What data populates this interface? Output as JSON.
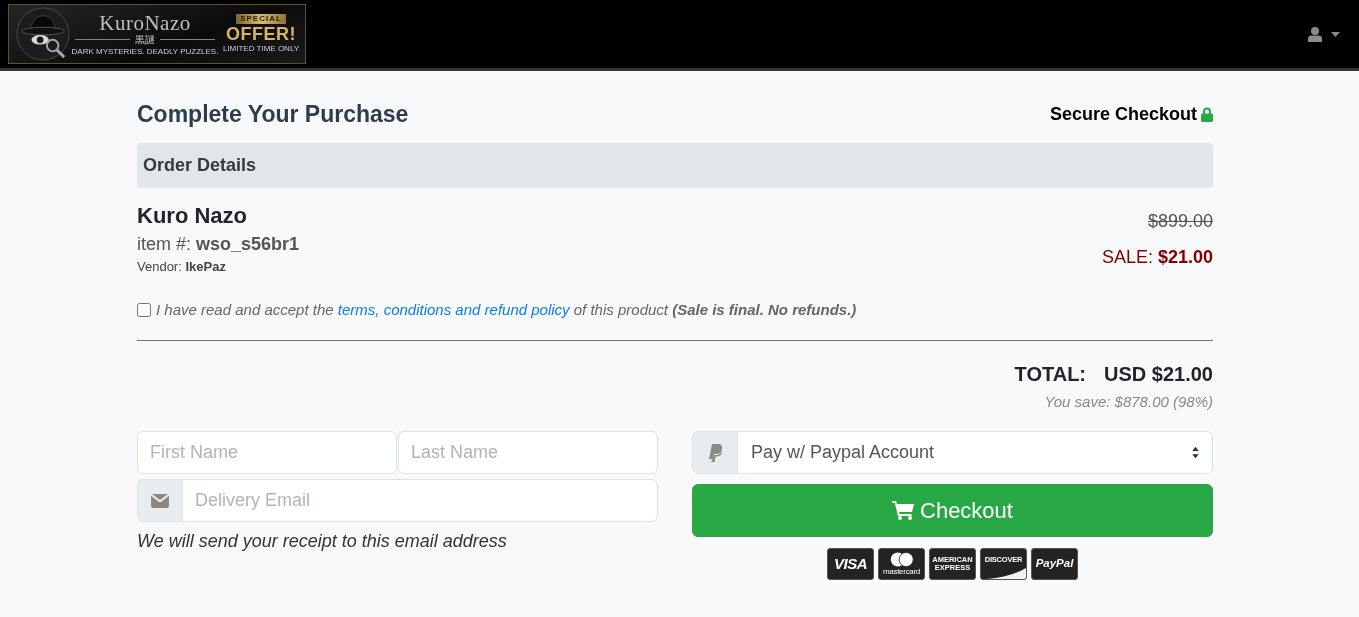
{
  "header": {
    "logo": {
      "brand": "KuroNazo",
      "subtitle": "黒謎",
      "tagline": "DARK MYSTERIES. DEADLY PUZZLES."
    },
    "promo": {
      "ribbon": "SPECIAL",
      "title": "OFFER!",
      "subtitle": "LIMITED TIME ONLY"
    }
  },
  "page": {
    "title": "Complete Your Purchase",
    "secure_label": "Secure Checkout"
  },
  "order": {
    "heading": "Order Details",
    "product_name": "Kuro Nazo",
    "item_line": "item #: **wso_s56br1**",
    "vendor_line": "Vendor: **IkePaz**",
    "original_price": "$899.00",
    "sale_line": "SALE: **$21.00**"
  },
  "terms": {
    "checked": false,
    "text_before": "I have read and accept the",
    "link": "terms, conditions and refund policy",
    "text_after": "of this product **(Sale is final. No refunds.)**"
  },
  "totals": {
    "label": "TOTAL:",
    "amount": "USD $21.00",
    "savings": "You save: $878.00 (98%)"
  },
  "form": {
    "first_name": {
      "placeholder": "First Name"
    },
    "last_name": {
      "placeholder": "Last Name"
    },
    "email": {
      "placeholder": "Delivery Email"
    },
    "email_note": "We will send your receipt to this email address"
  },
  "payment": {
    "method": "Pay w/ Paypal Account",
    "checkout_label": "Checkout",
    "cards": [
      {
        "kind": "visa",
        "label": "VISA"
      },
      {
        "kind": "mastercard",
        "label": "mastercard"
      },
      {
        "kind": "amex",
        "label": "AMERICAN EXPRESS"
      },
      {
        "kind": "discover",
        "label": "DISCOVER"
      },
      {
        "kind": "paypal",
        "label": "PayPal"
      }
    ]
  }
}
